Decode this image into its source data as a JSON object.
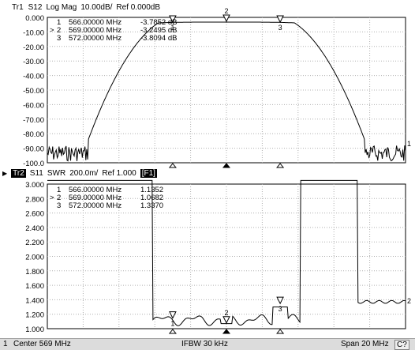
{
  "trace1": {
    "id": "Tr1",
    "param": "S12",
    "format": "Log Mag",
    "scale": "10.00dB/",
    "ref": "Ref 0.000dB",
    "yticks": [
      "0.000",
      "-10.00",
      "-20.00",
      "-30.00",
      "-40.00",
      "-50.00",
      "-60.00",
      "-70.00",
      "-80.00",
      "-90.00",
      "-100.0"
    ],
    "ref_marker_label": "1",
    "markers": [
      {
        "prefix": " ",
        "num": "1",
        "freq": "566.00000 MHz",
        "value": "-3.7852 dB"
      },
      {
        "prefix": ">",
        "num": "2",
        "freq": "569.00000 MHz",
        "value": "-3.2495 dB"
      },
      {
        "prefix": " ",
        "num": "3",
        "freq": "572.00000 MHz",
        "value": "-3.8094 dB"
      }
    ]
  },
  "trace2": {
    "id": "Tr2",
    "param": "S11",
    "format": "SWR",
    "scale": "200.0m/",
    "ref": "Ref 1.000",
    "channel": "[F1]",
    "yticks": [
      "3.000",
      "2.800",
      "2.600",
      "2.400",
      "2.200",
      "2.000",
      "1.800",
      "1.600",
      "1.400",
      "1.200",
      "1.000"
    ],
    "ref_marker_label": "2",
    "markers": [
      {
        "prefix": " ",
        "num": "1",
        "freq": "566.00000 MHz",
        "value": "1.1352"
      },
      {
        "prefix": ">",
        "num": "2",
        "freq": "569.00000 MHz",
        "value": "1.0682"
      },
      {
        "prefix": " ",
        "num": "3",
        "freq": "572.00000 MHz",
        "value": "1.3370"
      }
    ]
  },
  "status": {
    "channel": "1",
    "center": "Center 569 MHz",
    "ifbw": "IFBW 30 kHz",
    "span": "Span 20 MHz",
    "cal": "C?"
  }
}
